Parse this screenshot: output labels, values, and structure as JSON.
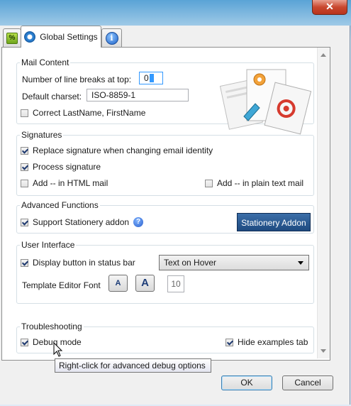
{
  "window": {
    "close_glyph": "✕"
  },
  "tabs": [
    {
      "label": "",
      "icon": "percent-icon",
      "icon_glyph": "%"
    },
    {
      "label": "Global Settings",
      "icon": "gear-icon"
    },
    {
      "label": "",
      "icon": "info-icon",
      "icon_glyph": "i"
    }
  ],
  "mail_content": {
    "title": "Mail Content",
    "line_breaks_label": "Number of line breaks at top:",
    "line_breaks_value": "0",
    "charset_label": "Default charset:",
    "charset_value": "ISO-8859-1",
    "correct_name_label": "Correct LastName, FirstName",
    "correct_name_checked": false
  },
  "signatures": {
    "title": "Signatures",
    "replace_label": "Replace signature when changing email identity",
    "replace_checked": true,
    "process_label": "Process signature",
    "process_checked": true,
    "html_label": "Add -- in HTML mail",
    "html_checked": false,
    "plain_label": "Add -- in plain text mail",
    "plain_checked": false
  },
  "advanced": {
    "title": "Advanced Functions",
    "stationery_label": "Support Stationery addon",
    "stationery_checked": true,
    "help_glyph": "?",
    "stationery_button": "Stationery Addon"
  },
  "user_interface": {
    "title": "User Interface",
    "status_bar_label": "Display button in status bar",
    "status_bar_checked": true,
    "status_bar_option": "Text on Hover",
    "font_label": "Template Editor Font",
    "font_small_glyph": "A",
    "font_large_glyph": "A",
    "font_size": "10"
  },
  "troubleshooting": {
    "title": "Troubleshooting",
    "debug_label": "Debug mode",
    "debug_checked": true,
    "hide_examples_label": "Hide examples tab",
    "hide_examples_checked": true
  },
  "tooltip": "Right-click for advanced debug options",
  "buttons": {
    "ok": "OK",
    "cancel": "Cancel"
  },
  "colors": {
    "accent": "#1e4a80",
    "focus": "#3399ff"
  }
}
